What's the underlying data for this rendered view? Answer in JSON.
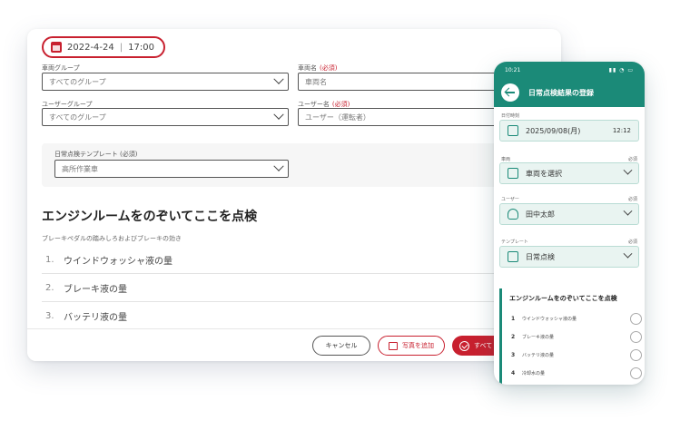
{
  "desktop": {
    "date": "2022-4-24",
    "date_sep": "|",
    "time": "17:00",
    "vehicle_group_label": "車両グループ",
    "vehicle_group_value": "すべてのグループ",
    "vehicle_name_label": "車両名",
    "vehicle_name_req": "(必須)",
    "vehicle_name_placeholder": "車両名",
    "user_group_label": "ユーザーグループ",
    "user_group_value": "すべてのグループ",
    "user_name_label": "ユーザー名",
    "user_name_req": "(必須)",
    "user_name_placeholder": "ユーザー（運転者）",
    "template_label": "日常点検テンプレート (必須)",
    "template_value": "高所作業車",
    "section_title": "エンジンルームをのぞいてここを点検",
    "section_sub": "ブレーキペダルの踏みしろおよびブレーキの効き",
    "items": [
      {
        "num": "1.",
        "text": "ウインドウォッシャ液の量"
      },
      {
        "num": "2.",
        "text": "ブレーキ液の量"
      },
      {
        "num": "3.",
        "text": "バッテリ液の量"
      }
    ],
    "cancel_label": "キャンセル",
    "add_photo_label": "写真を追加",
    "all_label": "すべて"
  },
  "phone": {
    "status_time": "10:21",
    "status_icons": "▮▮ ◔ ▭",
    "title": "日常点検結果の登録",
    "datetime_label": "日付時刻",
    "date_value": "2025/09/08(月)",
    "time_value": "12:12",
    "vehicle_label": "車両",
    "vehicle_req": "必須",
    "vehicle_value": "車両を選択",
    "user_label": "ユーザー",
    "user_req": "必須",
    "user_value": "田中太郎",
    "template_label": "テンプレート",
    "template_req": "必須",
    "template_value": "日常点検",
    "section_title": "エンジンルームをのぞいてここを点検",
    "items": [
      {
        "num": "1",
        "text": "ウインドウォッシャ液の量"
      },
      {
        "num": "2",
        "text": "ブレーキ液の量"
      },
      {
        "num": "3",
        "text": "バッテリ液の量"
      },
      {
        "num": "4",
        "text": "冷却水の量"
      }
    ]
  },
  "colors": {
    "brand_red": "#c8202f",
    "brand_teal": "#1b8a78"
  }
}
